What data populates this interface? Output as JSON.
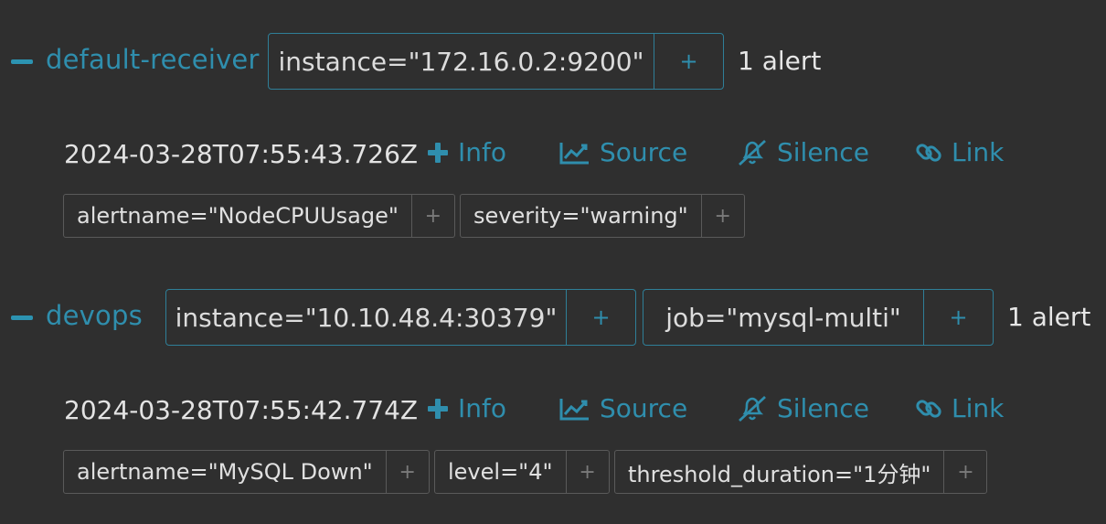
{
  "groups": [
    {
      "receiver": "default-receiver",
      "labels": [
        {
          "text": "instance=\"172.16.0.2:9200\"",
          "plus": "+"
        }
      ],
      "count": "1 alert",
      "alert": {
        "timestamp": "2024-03-28T07:55:43.726Z",
        "actions": {
          "info": "Info",
          "source": "Source",
          "silence": "Silence",
          "link": "Link"
        },
        "labels": [
          {
            "text": "alertname=\"NodeCPUUsage\"",
            "plus": "+"
          },
          {
            "text": "severity=\"warning\"",
            "plus": "+"
          }
        ]
      }
    },
    {
      "receiver": "devops",
      "labels": [
        {
          "text": "instance=\"10.10.48.4:30379\"",
          "plus": "+"
        },
        {
          "text": "job=\"mysql-multi\"",
          "plus": "+"
        }
      ],
      "count": "1 alert",
      "alert": {
        "timestamp": "2024-03-28T07:55:42.774Z",
        "actions": {
          "info": "Info",
          "source": "Source",
          "silence": "Silence",
          "link": "Link"
        },
        "labels": [
          {
            "text": "alertname=\"MySQL Down\"",
            "plus": "+"
          },
          {
            "text": "level=\"4\"",
            "plus": "+"
          },
          {
            "text": "threshold_duration=\"1分钟\"",
            "plus": "+"
          }
        ]
      }
    }
  ],
  "icons": {
    "collapse": "minus-icon",
    "info": "plus-icon",
    "source": "chart-line-icon",
    "silence": "bell-slash-icon",
    "link": "link-icon"
  },
  "colors": {
    "background": "#2f2f2f",
    "accent": "#2f8ead",
    "text": "#e6e6e6",
    "chip_border": "#5a5a5a"
  }
}
